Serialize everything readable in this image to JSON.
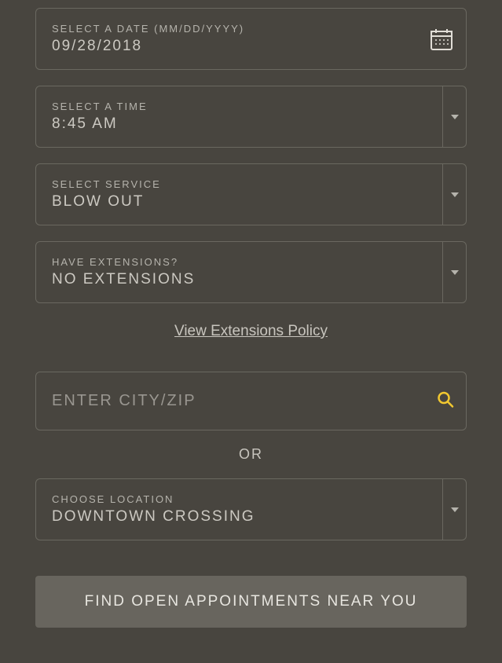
{
  "date": {
    "label": "SELECT A DATE (MM/DD/YYYY)",
    "value": "09/28/2018"
  },
  "time": {
    "label": "SELECT A TIME",
    "value": "8:45 AM"
  },
  "service": {
    "label": "SELECT SERVICE",
    "value": "BLOW OUT"
  },
  "extensions": {
    "label": "HAVE EXTENSIONS?",
    "value": "NO EXTENSIONS"
  },
  "policy_link": "View Extensions Policy",
  "search": {
    "placeholder": "ENTER CITY/ZIP"
  },
  "or_text": "OR",
  "location": {
    "label": "CHOOSE LOCATION",
    "value": "DOWNTOWN CROSSING"
  },
  "submit_label": "FIND OPEN APPOINTMENTS NEAR YOU"
}
